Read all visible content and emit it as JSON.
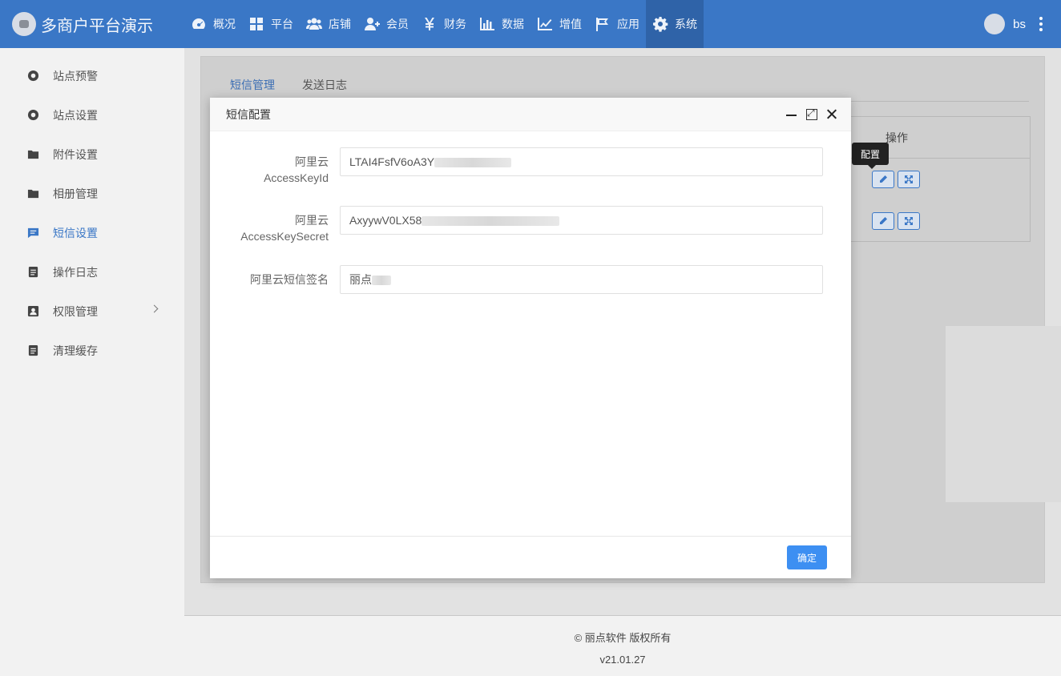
{
  "header": {
    "brand_title": "多商户平台演示",
    "nav": [
      {
        "label": "概况",
        "icon": "dashboard-icon"
      },
      {
        "label": "平台",
        "icon": "grid-icon"
      },
      {
        "label": "店铺",
        "icon": "users-icon"
      },
      {
        "label": "会员",
        "icon": "user-plus-icon"
      },
      {
        "label": "财务",
        "icon": "yen-icon"
      },
      {
        "label": "数据",
        "icon": "bar-chart-icon"
      },
      {
        "label": "增值",
        "icon": "line-chart-icon"
      },
      {
        "label": "应用",
        "icon": "flag-icon"
      },
      {
        "label": "系统",
        "icon": "gear-icon",
        "active": true
      }
    ],
    "user_name": "bs"
  },
  "sidebar": {
    "items": [
      {
        "label": "站点预警",
        "icon": "circle-dot-icon"
      },
      {
        "label": "站点设置",
        "icon": "circle-dot-icon"
      },
      {
        "label": "附件设置",
        "icon": "folder-icon"
      },
      {
        "label": "相册管理",
        "icon": "folder-icon"
      },
      {
        "label": "短信设置",
        "icon": "message-icon",
        "active": true
      },
      {
        "label": "操作日志",
        "icon": "document-icon"
      },
      {
        "label": "权限管理",
        "icon": "contact-icon",
        "has_children": true
      },
      {
        "label": "清理缓存",
        "icon": "document-icon"
      }
    ]
  },
  "main": {
    "tabs": [
      {
        "label": "短信管理",
        "active": true
      },
      {
        "label": "发送日志"
      }
    ],
    "table_header_action": "操作",
    "tooltip": "配置"
  },
  "modal": {
    "title": "短信配置",
    "fields": [
      {
        "label_line1": "阿里云",
        "label_line2": "AccessKeyId",
        "value": "LTAI4FsfV6oA3Y"
      },
      {
        "label_line1": "阿里云",
        "label_line2": "AccessKeySecret",
        "value": "AxyywV0LX58"
      },
      {
        "label_line1": "阿里云短信签名",
        "label_line2": "",
        "value": "丽点"
      }
    ],
    "confirm_label": "确定"
  },
  "footer": {
    "copyright": "© 丽点软件 版权所有",
    "version": "v21.01.27"
  },
  "colors": {
    "header_bg": "#3a77c6",
    "accent": "#3a77c6",
    "confirm_button": "#3d8ff2"
  }
}
